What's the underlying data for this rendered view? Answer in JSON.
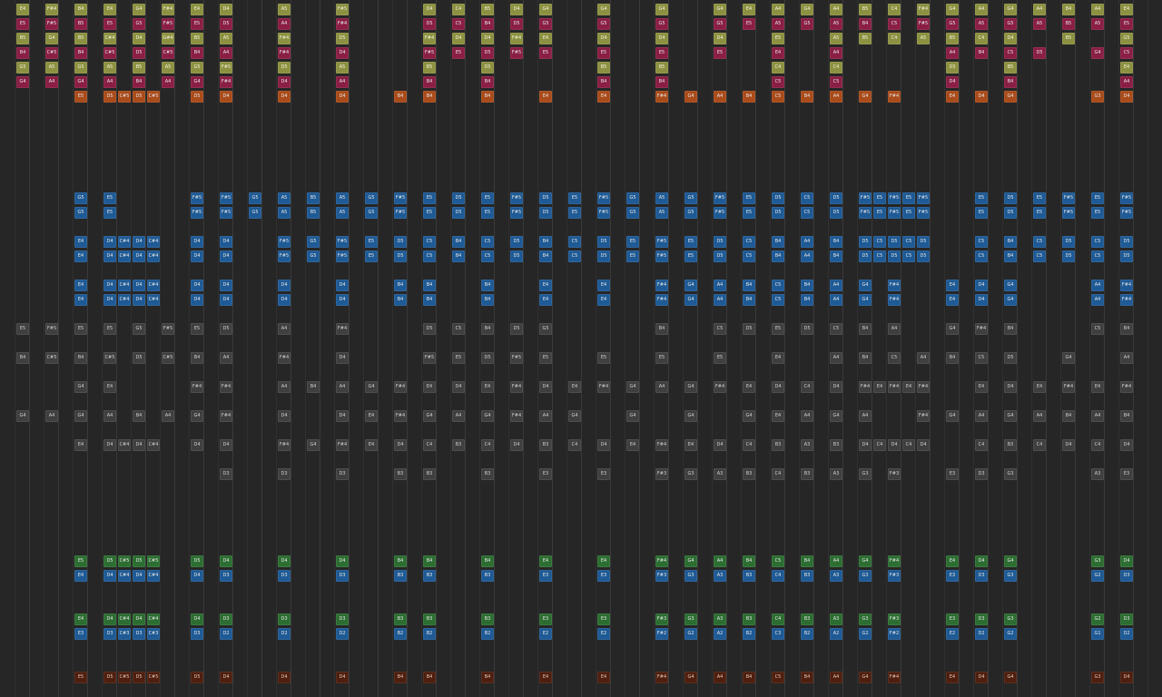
{
  "colors": {
    "background": "#262626",
    "column_line": "#3a3a3a",
    "yellow": "#8c9141",
    "magenta": "#8a1e44",
    "orange": "#a94b1a",
    "blue": "#1e5a95",
    "gray": "#3f3f3f",
    "green": "#2c6e31",
    "brown": "#4e1e0f"
  },
  "tracks": [
    {
      "name": "top-1",
      "type": "yellow",
      "notes": [
        "E4",
        "F#4",
        "B4",
        "E4",
        "G4",
        "F#4",
        "E4",
        "D4",
        "",
        "A5",
        "",
        "F#5",
        "",
        "",
        "D4",
        "C4",
        "B5",
        "D4",
        "G4",
        "",
        "G4",
        "",
        "G4",
        "",
        "G4",
        "E4",
        "A4",
        "G4",
        "A4",
        "B5",
        "C4",
        "F#4",
        "G4",
        "A4",
        "G4",
        "A4",
        "B4",
        "A4",
        "E4"
      ]
    },
    {
      "name": "top-2",
      "type": "magenta",
      "notes": [
        "E5",
        "F#5",
        "B5",
        "E5",
        "G5",
        "F#5",
        "E5",
        "D5",
        "",
        "A4",
        "",
        "F#4",
        "",
        "",
        "D5",
        "C5",
        "B4",
        "D5",
        "G5",
        "",
        "G5",
        "",
        "G5",
        "",
        "G5",
        "E5",
        "A5",
        "G5",
        "A5",
        "B4",
        "C5",
        "F#5",
        "G5",
        "A5",
        "G5",
        "A5",
        "B5",
        "A5",
        "E5"
      ]
    },
    {
      "name": "top-3",
      "type": "yellow",
      "notes": [
        "B5",
        "G4",
        "B5",
        "C#4",
        "D4",
        "G#4",
        "B5",
        "A5",
        "",
        "F#4",
        "",
        "D5",
        "",
        "",
        "F#4",
        "D4",
        "D4",
        "F#4",
        "E4",
        "",
        "D4",
        "",
        "D4",
        "",
        "D4",
        "",
        "E5",
        "",
        "A5",
        "B5",
        "C4",
        "A5",
        "B5",
        "C4",
        "D4",
        "",
        "B5",
        "",
        "G5"
      ]
    },
    {
      "name": "top-4",
      "type": "magenta",
      "notes": [
        "B4",
        "C#5",
        "B4",
        "C#5",
        "D5",
        "C#5",
        "B4",
        "A4",
        "",
        "F#4",
        "",
        "D4",
        "",
        "",
        "F#5",
        "E5",
        "D5",
        "F#5",
        "E5",
        "",
        "E5",
        "",
        "E5",
        "",
        "E5",
        "",
        "E4",
        "",
        "A4",
        "",
        "",
        "",
        "A4",
        "B4",
        "C5",
        "D5",
        "",
        "G4",
        "C5"
      ]
    },
    {
      "name": "top-5",
      "type": "yellow",
      "notes": [
        "G5",
        "A5",
        "G5",
        "A5",
        "B5",
        "A5",
        "G5",
        "F#5",
        "",
        "D5",
        "",
        "A5",
        "",
        "",
        "B5",
        "",
        "D5",
        "",
        "",
        "",
        "B5",
        "",
        "B5",
        "",
        "",
        "",
        "C4",
        "",
        "C4",
        "",
        "",
        "",
        "D5",
        "",
        "B5",
        "",
        "",
        "",
        "E4"
      ]
    },
    {
      "name": "top-6",
      "type": "magenta",
      "notes": [
        "G4",
        "A4",
        "G4",
        "A4",
        "B4",
        "A4",
        "G4",
        "F#4",
        "",
        "D4",
        "",
        "A4",
        "",
        "",
        "B4",
        "",
        "B4",
        "",
        "",
        "",
        "B4",
        "",
        "B4",
        "",
        "",
        "",
        "C5",
        "",
        "C5",
        "",
        "",
        "",
        "D4",
        "",
        "B4",
        "",
        "",
        "",
        "A4"
      ]
    },
    {
      "name": "top-7",
      "type": "orange",
      "notes": [
        "",
        "",
        "E5",
        "D5 C#5 D5 C#5",
        "",
        "",
        "D5",
        "D4",
        "",
        "D4",
        "",
        "D4",
        "",
        "B4",
        "B4",
        "",
        "B4",
        "",
        "E4",
        "",
        "E4",
        "",
        "F#4",
        "G4",
        "A4",
        "B4",
        "C5",
        "B4",
        "A4",
        "G4",
        "F#4",
        "",
        "E4",
        "D4",
        "G4",
        "",
        "",
        "G3",
        "D4"
      ]
    },
    {
      "name": "mid-blue-1",
      "type": "blue",
      "notes": [
        "",
        "",
        "G5",
        "E5",
        "",
        "",
        "F#5",
        "F#5",
        "G5",
        "A5",
        "B5",
        "A5",
        "G5",
        "F#5",
        "E5",
        "D5",
        "E5",
        "F#5",
        "D5",
        "E5",
        "F#5",
        "G5",
        "A5",
        "G5",
        "F#5",
        "E5",
        "D5",
        "C5",
        "D5",
        "F#5 E5 F#5 E5 F#5",
        "",
        "",
        "",
        "E5",
        "D5",
        "E5",
        "F#5",
        "E5",
        "F#5"
      ]
    },
    {
      "name": "mid-blue-2",
      "type": "blue",
      "notes": [
        "",
        "",
        "E4",
        "D4 C#4 D4 C#4",
        "",
        "",
        "D4",
        "D4",
        "",
        "F#5",
        "G5",
        "F#5",
        "E5",
        "D5",
        "C5",
        "B4",
        "C5",
        "D5",
        "B4",
        "C5",
        "D5",
        "E5",
        "F#5",
        "E5",
        "D5",
        "C5",
        "B4",
        "A4",
        "B4",
        "D5 C5 D5 C5 D5",
        "",
        "",
        "",
        "C5",
        "B4",
        "C5",
        "D5",
        "C5",
        "D5"
      ]
    },
    {
      "name": "mid-blue-3",
      "type": "blue",
      "notes": [
        "",
        "",
        "E4",
        "D4 C#4 D4 C#4",
        "",
        "",
        "D4",
        "D4",
        "",
        "D4",
        "",
        "D4",
        "",
        "B4",
        "B4",
        "",
        "B4",
        "",
        "E4",
        "",
        "E4",
        "",
        "F#4",
        "G4",
        "A4",
        "B4",
        "C5",
        "B4",
        "A4",
        "G4",
        "F#4",
        "",
        "E4",
        "D4",
        "G4",
        "",
        "",
        "A4",
        "F#4"
      ]
    },
    {
      "name": "gray-1",
      "type": "gray",
      "notes": [
        "E5",
        "F#5",
        "E5",
        "E5",
        "G5",
        "F#5",
        "E5",
        "D5",
        "",
        "A4",
        "",
        "F#4",
        "",
        "",
        "D5",
        "C5",
        "B4",
        "D5",
        "G5",
        "",
        "",
        "",
        "B4",
        "",
        "C5",
        "D5",
        "E5",
        "D5",
        "C5",
        "B4",
        "A4",
        "",
        "G4",
        "F#4",
        "B4",
        "",
        "",
        "C5",
        "B4"
      ]
    },
    {
      "name": "gray-2",
      "type": "gray",
      "notes": [
        "B4",
        "C#5",
        "B4",
        "C#5",
        "D5",
        "C#5",
        "B4",
        "A4",
        "",
        "F#4",
        "",
        "D4",
        "",
        "",
        "F#5",
        "E5",
        "D5",
        "F#5",
        "E5",
        "",
        "E5",
        "",
        "E5",
        "",
        "E5",
        "",
        "E4",
        "",
        "A4",
        "B4",
        "C5",
        "A4",
        "B4",
        "C5",
        "D5",
        "",
        "G4",
        "",
        "A4"
      ]
    },
    {
      "name": "gray-3",
      "type": "gray",
      "notes": [
        "",
        "",
        "G4",
        "E4",
        "",
        "",
        "F#4",
        "F#4",
        "",
        "A4",
        "B4",
        "A4",
        "G4",
        "F#4",
        "E4",
        "D4",
        "E4",
        "F#4",
        "D4",
        "E4",
        "F#4",
        "G4",
        "A4",
        "G4",
        "F#4",
        "E4",
        "D4",
        "C4",
        "D4",
        "F#4 E4 F#4 E4 F#4",
        "",
        "",
        "",
        "E4",
        "D4",
        "E4",
        "F#4",
        "E4",
        "F#4"
      ]
    },
    {
      "name": "gray-4",
      "type": "gray",
      "notes": [
        "G4",
        "A4",
        "G4",
        "A4",
        "B4",
        "A4",
        "G4",
        "F#4",
        "",
        "D4",
        "",
        "D4",
        "E4",
        "F#4",
        "G4",
        "A4",
        "G4",
        "F#4",
        "A4",
        "G4",
        "",
        "G4",
        "",
        "G4",
        "",
        "G4",
        "E4",
        "A4",
        "G4",
        "A4",
        "",
        "F#4",
        "G4",
        "A4",
        "G4",
        "A4",
        "B4",
        "A4",
        "B4"
      ]
    },
    {
      "name": "gray-5",
      "type": "gray",
      "notes": [
        "",
        "",
        "E4",
        "D4 C#4 D4 C#4",
        "",
        "",
        "D4",
        "D4",
        "",
        "F#4",
        "G4",
        "F#4",
        "E4",
        "D4",
        "C4",
        "B3",
        "C4",
        "D4",
        "B3",
        "C4",
        "D4",
        "E4",
        "F#4",
        "E4",
        "D4",
        "C4",
        "B3",
        "A3",
        "B3",
        "D4 C4 D4 C4 D4",
        "",
        "",
        "",
        "C4",
        "B3",
        "C4",
        "D4",
        "C4",
        "D4"
      ]
    },
    {
      "name": "gray-6",
      "type": "gray",
      "notes": [
        "",
        "",
        "",
        "",
        "",
        "",
        "",
        "D3",
        "",
        "D3",
        "",
        "D3",
        "",
        "B3",
        "B3",
        "",
        "B3",
        "",
        "E3",
        "",
        "E3",
        "",
        "F#3",
        "G3",
        "A3",
        "B3",
        "C4",
        "B3",
        "A3",
        "G3",
        "F#3",
        "",
        "E3",
        "D3",
        "G3",
        "",
        "",
        "A3",
        "E3"
      ]
    },
    {
      "name": "bottom-green-1",
      "type": "green",
      "notes": [
        "",
        "",
        "E5",
        "D5 C#5 D5 C#5",
        "",
        "",
        "D5",
        "D4",
        "",
        "D4",
        "",
        "D4",
        "",
        "B4",
        "B4",
        "",
        "B4",
        "",
        "E4",
        "",
        "E4",
        "",
        "F#4",
        "G4",
        "A4",
        "B4",
        "C5",
        "B4",
        "A4",
        "G4",
        "F#4",
        "",
        "E4",
        "D4",
        "G4",
        "",
        "",
        "G3",
        "D4"
      ]
    },
    {
      "name": "bottom-blue-1",
      "type": "blue",
      "notes": [
        "",
        "",
        "E4",
        "D4 C#4 D4 C#4",
        "",
        "",
        "D4",
        "D3",
        "",
        "D3",
        "",
        "D3",
        "",
        "B3",
        "B3",
        "",
        "B3",
        "",
        "E3",
        "",
        "E3",
        "",
        "F#3",
        "G3",
        "A3",
        "B3",
        "C4",
        "B3",
        "A3",
        "G3",
        "F#3",
        "",
        "E3",
        "D3",
        "G3",
        "",
        "",
        "G2",
        "D3"
      ]
    },
    {
      "name": "bottom-green-2",
      "type": "green",
      "notes": [
        "",
        "",
        "E4",
        "D4 C#4 D4 C#4",
        "",
        "",
        "D4",
        "D3",
        "",
        "D3",
        "",
        "D3",
        "",
        "B3",
        "B3",
        "",
        "B3",
        "",
        "E3",
        "",
        "E3",
        "",
        "F#3",
        "G3",
        "A3",
        "B3",
        "C4",
        "B3",
        "A3",
        "G3",
        "F#3",
        "",
        "E3",
        "D3",
        "G3",
        "",
        "",
        "G2",
        "D3"
      ]
    },
    {
      "name": "bottom-blue-2",
      "type": "blue",
      "notes": [
        "",
        "",
        "E3",
        "D3 C#3 D3 C#3",
        "",
        "",
        "D3",
        "D2",
        "",
        "D2",
        "",
        "D2",
        "",
        "B2",
        "B2",
        "",
        "B2",
        "",
        "E2",
        "",
        "E2",
        "",
        "F#2",
        "G2",
        "A2",
        "B2",
        "C3",
        "B2",
        "A2",
        "G2",
        "F#2",
        "",
        "E2",
        "D2",
        "G2",
        "",
        "",
        "G1",
        "D2"
      ]
    },
    {
      "name": "bottom-brown",
      "type": "brown",
      "notes": [
        "",
        "",
        "E5",
        "D5 C#5 D5 C#5",
        "",
        "",
        "D5",
        "D4",
        "",
        "D4",
        "",
        "D4",
        "",
        "B4",
        "B4",
        "",
        "B4",
        "",
        "E4",
        "",
        "E4",
        "",
        "F#4",
        "G4",
        "A4",
        "B4",
        "C5",
        "B4",
        "A4",
        "G4",
        "F#4",
        "",
        "E4",
        "D4",
        "G4",
        "",
        "",
        "G3",
        "D4"
      ]
    }
  ]
}
